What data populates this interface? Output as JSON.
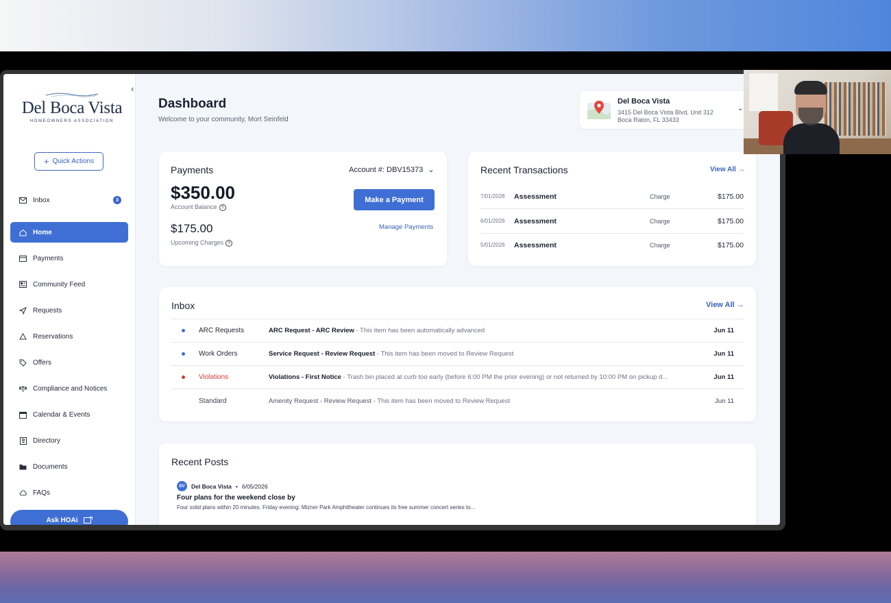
{
  "sidebar": {
    "logo": {
      "name": "Del Boca Vista",
      "tagline": "HOMEOWNERS ASSOCIATION"
    },
    "quick_actions_label": "Quick Actions",
    "inbox": {
      "label": "Inbox",
      "count": "3"
    },
    "items": [
      {
        "label": "Home",
        "icon": "home-icon",
        "active": true
      },
      {
        "label": "Payments",
        "icon": "card-icon"
      },
      {
        "label": "Community Feed",
        "icon": "newspaper-icon"
      },
      {
        "label": "Requests",
        "icon": "send-icon"
      },
      {
        "label": "Reservations",
        "icon": "tent-icon"
      },
      {
        "label": "Offers",
        "icon": "tag-icon"
      },
      {
        "label": "Compliance and Notices",
        "icon": "scale-icon"
      },
      {
        "label": "Calendar & Events",
        "icon": "calendar-icon"
      },
      {
        "label": "Directory",
        "icon": "book-icon"
      },
      {
        "label": "Documents",
        "icon": "folder-icon"
      },
      {
        "label": "FAQs",
        "icon": "cloud-icon"
      }
    ],
    "ask_label": "Ask HOAi"
  },
  "header": {
    "title": "Dashboard",
    "subtitle": "Welcome to your community, Mort Seinfeld"
  },
  "location": {
    "name": "Del Boca Vista",
    "address1": "3415 Del Boca Vista Blvd, Unit 312",
    "address2": "Boca Raton, FL 33433"
  },
  "payments": {
    "title": "Payments",
    "account": "Account #: DBV15373",
    "balance": "$350.00",
    "balance_label": "Account Balance",
    "upcoming": "$175.00",
    "upcoming_label": "Upcoming Charges",
    "pay_button": "Make a Payment",
    "manage_link": "Manage Payments"
  },
  "transactions": {
    "title": "Recent Transactions",
    "view_all": "View All",
    "rows": [
      {
        "date": "7/01/2026",
        "name": "Assessment",
        "type": "Charge",
        "amount": "$175.00"
      },
      {
        "date": "6/01/2026",
        "name": "Assessment",
        "type": "Charge",
        "amount": "$175.00"
      },
      {
        "date": "5/01/2026",
        "name": "Assessment",
        "type": "Charge",
        "amount": "$175.00"
      }
    ]
  },
  "inbox": {
    "title": "Inbox",
    "view_all": "View All",
    "rows": [
      {
        "category": "ARC Requests",
        "subject": "ARC Request - ARC Review",
        "detail": " - This item has been automatically advanced",
        "date": "Jun 11",
        "dot": "#3f6fd4",
        "unread": true
      },
      {
        "category": "Work Orders",
        "subject": "Service Request - Review Request",
        "detail": " - This item has been moved to Review Request",
        "date": "Jun 11",
        "dot": "#3f6fd4",
        "unread": true
      },
      {
        "category": "Violations",
        "subject": "Violations - First Notice",
        "detail": " - Trash bin placed at curb too early (before 6:00 PM the prior evening) or not returned by 10:00 PM on pickup d...",
        "date": "Jun 11",
        "dot": "#d83a3a",
        "unread": true
      },
      {
        "category": "Standard",
        "subject": "Amenity Request - Review Request",
        "detail": " - This item has been moved to Review Request",
        "date": "Jun 11",
        "dot": "",
        "unread": false
      }
    ]
  },
  "posts": {
    "title": "Recent Posts",
    "author_initials": "DV",
    "author": "Del Boca Vista",
    "date": "6/05/2026",
    "post_title": "Four plans for the weekend close by",
    "post_body": "Four solid plans within 20 minutes. Friday evening: Mizner Park Amphitheater continues its free summer concert series to..."
  },
  "colors": {
    "accent": "#3f6fd4",
    "violation": "#d83a3a"
  }
}
